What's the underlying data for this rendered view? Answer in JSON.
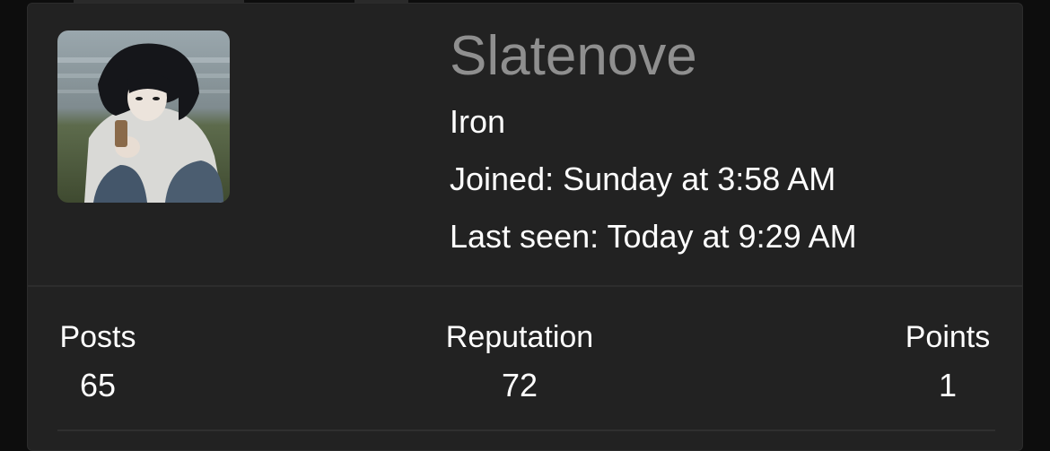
{
  "profile": {
    "username": "Slatenove",
    "rank": "Iron",
    "joined": "Joined: Sunday at 3:58 AM",
    "last_seen": "Last seen: Today at 9:29 AM"
  },
  "stats": [
    {
      "label": "Posts",
      "value": "65"
    },
    {
      "label": "Reputation",
      "value": "72"
    },
    {
      "label": "Points",
      "value": "1"
    }
  ],
  "colors": {
    "card_background": "#222222",
    "username": "#8f8f8f",
    "text": "#ffffff"
  }
}
